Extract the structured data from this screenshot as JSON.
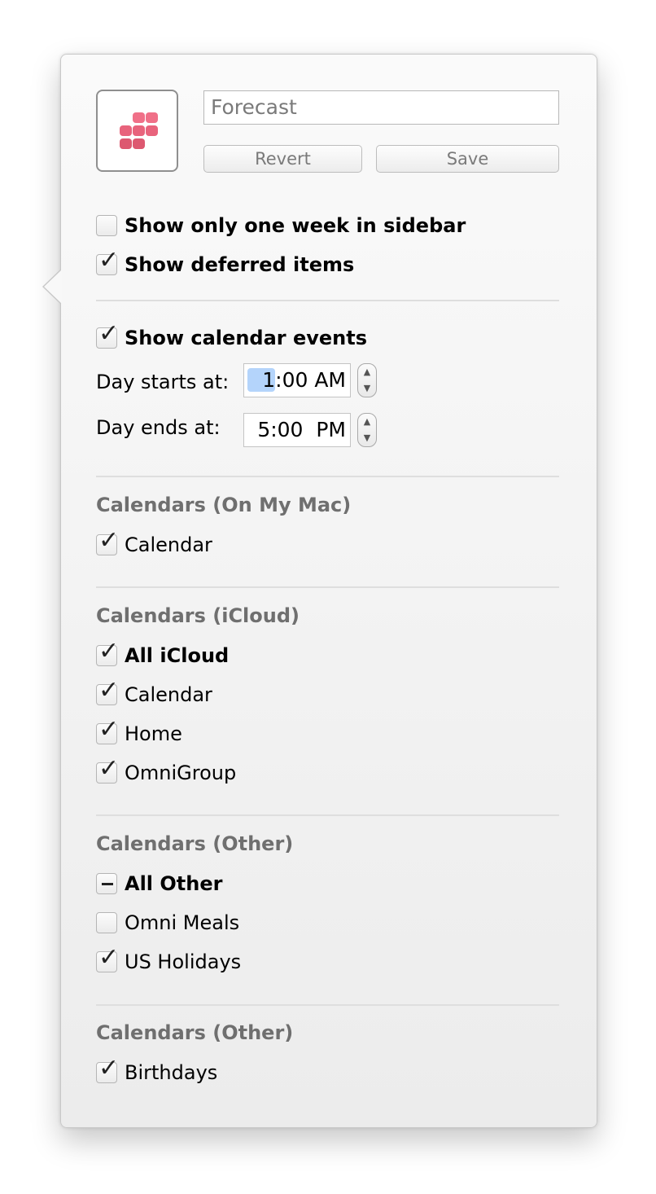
{
  "perspective": {
    "name": "Forecast",
    "icon": "forecast-icon",
    "icon_color": "#e05f77",
    "revert_label": "Revert",
    "save_label": "Save"
  },
  "options": [
    {
      "label": "Show only one week in sidebar",
      "checked": false
    },
    {
      "label": "Show deferred items",
      "checked": true
    }
  ],
  "calendar_events": {
    "label": "Show calendar events",
    "checked": true,
    "day_starts_label": "Day starts at:",
    "day_starts_hour": "1",
    "day_starts_rest": ":00 AM",
    "day_ends_label": "Day ends at:",
    "day_ends_value": "5:00  PM"
  },
  "groups": [
    {
      "title": "Calendars (On My Mac)",
      "items": [
        {
          "label": "Calendar",
          "state": "checked"
        }
      ]
    },
    {
      "title": "Calendars (iCloud)",
      "items": [
        {
          "label": "All iCloud",
          "state": "checked",
          "bold": true
        },
        {
          "label": "Calendar",
          "state": "checked"
        },
        {
          "label": "Home",
          "state": "checked"
        },
        {
          "label": "OmniGroup",
          "state": "checked"
        }
      ]
    },
    {
      "title": "Calendars (Other)",
      "items": [
        {
          "label": "All Other",
          "state": "mixed",
          "bold": true
        },
        {
          "label": "Omni Meals",
          "state": "unchecked"
        },
        {
          "label": "US Holidays",
          "state": "checked"
        }
      ]
    },
    {
      "title": "Calendars (Other)",
      "items": [
        {
          "label": "Birthdays",
          "state": "checked"
        }
      ]
    }
  ]
}
